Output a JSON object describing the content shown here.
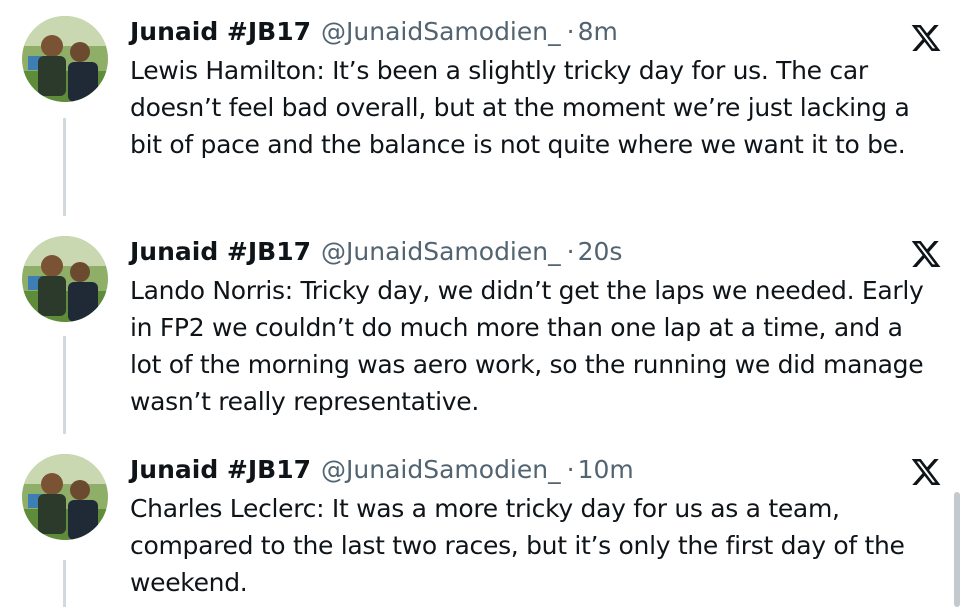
{
  "posts": [
    {
      "display_name": "Junaid #JB17",
      "handle": "@JunaidSamodien_",
      "separator": "·",
      "time": "8m",
      "text": "Lewis Hamilton: It’s been a slightly tricky day for us. The car doesn’t feel bad overall, but at the moment we’re just lacking a bit of pace and the balance is not quite where we want it to be."
    },
    {
      "display_name": "Junaid #JB17",
      "handle": "@JunaidSamodien_",
      "separator": "·",
      "time": "20s",
      "text": "Lando Norris: Tricky day, we didn’t get the laps we needed. Early in FP2 we couldn’t do much more than one lap at a time, and a lot of the morning was aero work, so the running we did manage wasn’t really representative."
    },
    {
      "display_name": "Junaid #JB17",
      "handle": "@JunaidSamodien_",
      "separator": "·",
      "time": "10m",
      "text": "Charles Leclerc: It was a more tricky day for us as a team, compared to the last two races, but it’s only the first day of the weekend."
    }
  ],
  "icons": {
    "platform_logo": "x-logo-icon",
    "avatar": "avatar"
  },
  "colors": {
    "name_text": "#0f1419",
    "secondary_text": "#536471",
    "thread_line": "#cfd9de",
    "background": "#ffffff"
  }
}
